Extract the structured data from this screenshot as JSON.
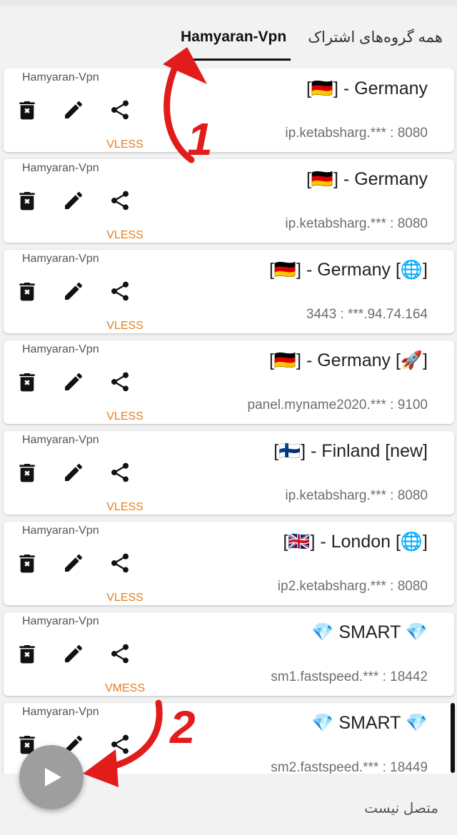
{
  "tabs": [
    {
      "label": "همه گروه‌های اشتراک",
      "active": false
    },
    {
      "label": "Hamyaran-Vpn",
      "active": true
    }
  ],
  "cards": [
    {
      "sub": "Hamyaran-Vpn",
      "title": "[🇩🇪] - Germany",
      "address": "ip.ketabsharg.*** : 8080",
      "protocol": "VLESS"
    },
    {
      "sub": "Hamyaran-Vpn",
      "title": "[🇩🇪] - Germany",
      "address": "ip.ketabsharg.*** : 8080",
      "protocol": "VLESS"
    },
    {
      "sub": "Hamyaran-Vpn",
      "title": "[🇩🇪] - Germany [🌐]",
      "address": "3443 : ***.94.74.164",
      "protocol": "VLESS"
    },
    {
      "sub": "Hamyaran-Vpn",
      "title": "[🇩🇪] - Germany [🚀]",
      "address": "panel.myname2020.*** : 9100",
      "protocol": "VLESS"
    },
    {
      "sub": "Hamyaran-Vpn",
      "title": "[🇫🇮] - Finland [new]",
      "address": "ip.ketabsharg.*** : 8080",
      "protocol": "VLESS"
    },
    {
      "sub": "Hamyaran-Vpn",
      "title": "[🇬🇧] - London [🌐]",
      "address": "ip2.ketabsharg.*** : 8080",
      "protocol": "VLESS"
    },
    {
      "sub": "Hamyaran-Vpn",
      "title": "💎 SMART 💎",
      "address": "sm1.fastspeed.*** : 18442",
      "protocol": "VMESS"
    },
    {
      "sub": "Hamyaran-Vpn",
      "title": "💎 SMART 💎",
      "address": "sm2.fastspeed.*** : 18449",
      "protocol": ""
    }
  ],
  "status": "متصل نیست",
  "annotations": {
    "one": "1",
    "two": "2"
  },
  "icons": {
    "delete": "delete-icon",
    "edit": "edit-icon",
    "share": "share-icon",
    "play": "play-icon"
  },
  "colors": {
    "protocol": "#e67e22",
    "annotation": "#e21b1b",
    "fab": "#9e9e9e"
  }
}
